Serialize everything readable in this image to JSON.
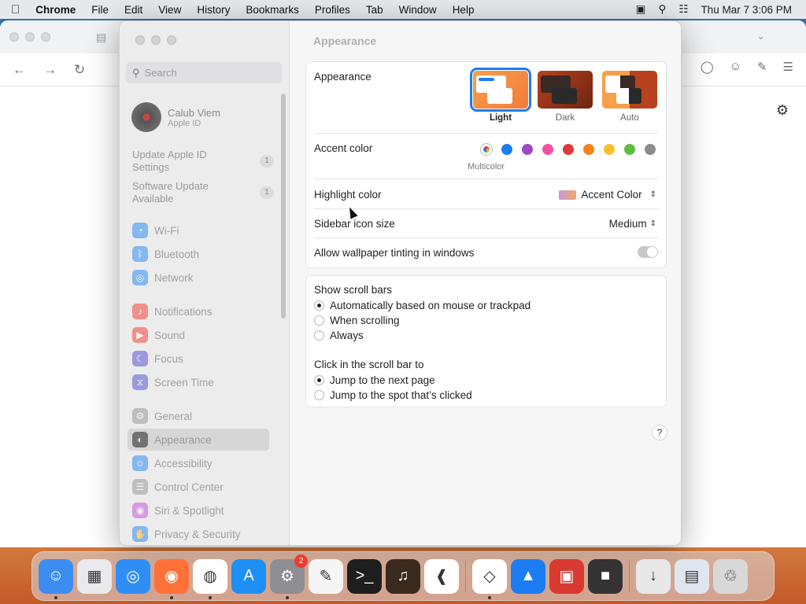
{
  "menubar": {
    "apple": "",
    "items": [
      "Chrome",
      "File",
      "Edit",
      "View",
      "History",
      "Bookmarks",
      "Profiles",
      "Tab",
      "Window",
      "Help"
    ],
    "datetime": "Thu Mar 7  3:06 PM"
  },
  "sidebar": {
    "search_placeholder": "Search",
    "account_name": "Calub Viem",
    "account_sub": "Apple ID",
    "notices": [
      {
        "label": "Update Apple ID Settings",
        "badge": "1"
      },
      {
        "label": "Software Update Available",
        "badge": "1"
      }
    ],
    "items": [
      {
        "label": "Wi-Fi",
        "icon": "wifi-icon",
        "color": "#2f8ef5"
      },
      {
        "label": "Bluetooth",
        "icon": "bluetooth-icon",
        "color": "#2f8ef5"
      },
      {
        "label": "Network",
        "icon": "globe-icon",
        "color": "#2f8ef5"
      },
      {
        "label": "Notifications",
        "icon": "bell-icon",
        "color": "#f2463c"
      },
      {
        "label": "Sound",
        "icon": "speaker-icon",
        "color": "#f2463c"
      },
      {
        "label": "Focus",
        "icon": "moon-icon",
        "color": "#5a56d6"
      },
      {
        "label": "Screen Time",
        "icon": "hourglass-icon",
        "color": "#5a56d6"
      },
      {
        "label": "General",
        "icon": "gear-icon",
        "color": "#9a9a9a"
      },
      {
        "label": "Appearance",
        "icon": "appearance-icon",
        "color": "#222222"
      },
      {
        "label": "Accessibility",
        "icon": "accessibility-icon",
        "color": "#2f8ef5"
      },
      {
        "label": "Control Center",
        "icon": "control-center-icon",
        "color": "#9a9a9a"
      },
      {
        "label": "Siri & Spotlight",
        "icon": "siri-icon",
        "color": "#c35bd8"
      },
      {
        "label": "Privacy & Security",
        "icon": "hand-icon",
        "color": "#2f8ef5"
      }
    ],
    "selected": "Appearance"
  },
  "main": {
    "title": "Appearance",
    "appearance_label": "Appearance",
    "appearance_options": [
      {
        "label": "Light",
        "selected": true
      },
      {
        "label": "Dark",
        "selected": false
      },
      {
        "label": "Auto",
        "selected": false
      }
    ],
    "accent_label": "Accent color",
    "accent_colors": [
      "multicolor",
      "#1c7cf4",
      "#9b4bc0",
      "#f74f9e",
      "#e0383e",
      "#f7821b",
      "#fcc02f",
      "#5ebd3e",
      "#8c8c8c"
    ],
    "accent_selected_label": "Multicolor",
    "highlight_label": "Highlight color",
    "highlight_value": "Accent Color",
    "sidebar_icon_label": "Sidebar icon size",
    "sidebar_icon_value": "Medium",
    "tinting_label": "Allow wallpaper tinting in windows",
    "tinting_on": false,
    "scroll_label": "Show scroll bars",
    "scroll_options": [
      {
        "label": "Automatically based on mouse or trackpad",
        "on": true
      },
      {
        "label": "When scrolling",
        "on": false
      },
      {
        "label": "Always",
        "on": false
      }
    ],
    "click_label": "Click in the scroll bar to",
    "click_options": [
      {
        "label": "Jump to the next page",
        "on": true
      },
      {
        "label": "Jump to the spot that’s clicked",
        "on": false
      }
    ],
    "help": "?"
  },
  "dock": {
    "apps": [
      {
        "name": "finder",
        "color": "#3b8ef0",
        "running": true
      },
      {
        "name": "launchpad",
        "color": "#e9e9ee",
        "running": false
      },
      {
        "name": "safari",
        "color": "#2f8ef5",
        "running": false
      },
      {
        "name": "firefox",
        "color": "#ff7139",
        "running": true
      },
      {
        "name": "chrome",
        "color": "#ffffff",
        "running": true
      },
      {
        "name": "app-store",
        "color": "#1d8ff5",
        "running": false
      },
      {
        "name": "system-settings",
        "color": "#8e8e93",
        "running": true,
        "badge": "2"
      },
      {
        "name": "textedit",
        "color": "#f5f5f5",
        "running": false
      },
      {
        "name": "terminal",
        "color": "#1e1e1e",
        "running": false
      },
      {
        "name": "garageband",
        "color": "#3a2a1e",
        "running": false
      },
      {
        "name": "vscode",
        "color": "#ffffff",
        "running": false
      },
      {
        "name": "unity",
        "color": "#ffffff",
        "running": true
      },
      {
        "name": "keynote",
        "color": "#1c7cf4",
        "running": false
      },
      {
        "name": "photo-booth",
        "color": "#d93a2f",
        "running": false
      },
      {
        "name": "screen-capture",
        "color": "#333333",
        "running": false
      },
      {
        "name": "downloads-stack",
        "color": "#e8e8e8",
        "running": false
      },
      {
        "name": "screenshot-stack",
        "color": "#dfe6f0",
        "running": false
      },
      {
        "name": "trash",
        "color": "#d8d8d8",
        "running": false
      }
    ]
  }
}
